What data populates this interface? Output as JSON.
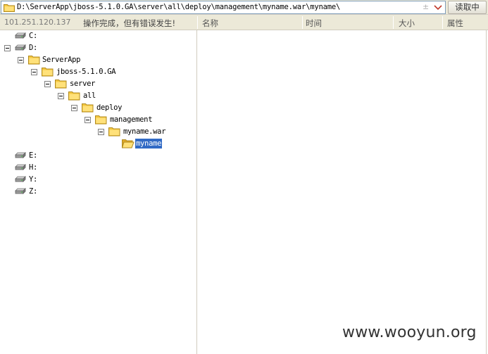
{
  "address_bar": {
    "path": "D:\\ServerApp\\jboss-5.1.0.GA\\server\\all\\deploy\\management\\myname.war\\myname\\",
    "extra_glyph": "±",
    "read_button": "读取中"
  },
  "header": {
    "ip": "101.251.120.137",
    "status": "操作完成，但有错误发生!",
    "columns": {
      "name": "名称",
      "time": "时间",
      "size": "大小",
      "attr": "属性"
    }
  },
  "tree": {
    "drive_c": "C:",
    "drive_d": "D:",
    "serverapp": "ServerApp",
    "jboss": "jboss-5.1.0.GA",
    "server": "server",
    "all": "all",
    "deploy": "deploy",
    "management": "management",
    "mynamewar": "myname.war",
    "myname": "myname",
    "drive_e": "E:",
    "drive_h": "H:",
    "drive_y": "Y:",
    "drive_z": "Z:"
  },
  "watermark": "www.wooyun.org",
  "colors": {
    "selection": "#316ac5",
    "folder": "#f5c842",
    "chrome": "#ece9d8"
  }
}
